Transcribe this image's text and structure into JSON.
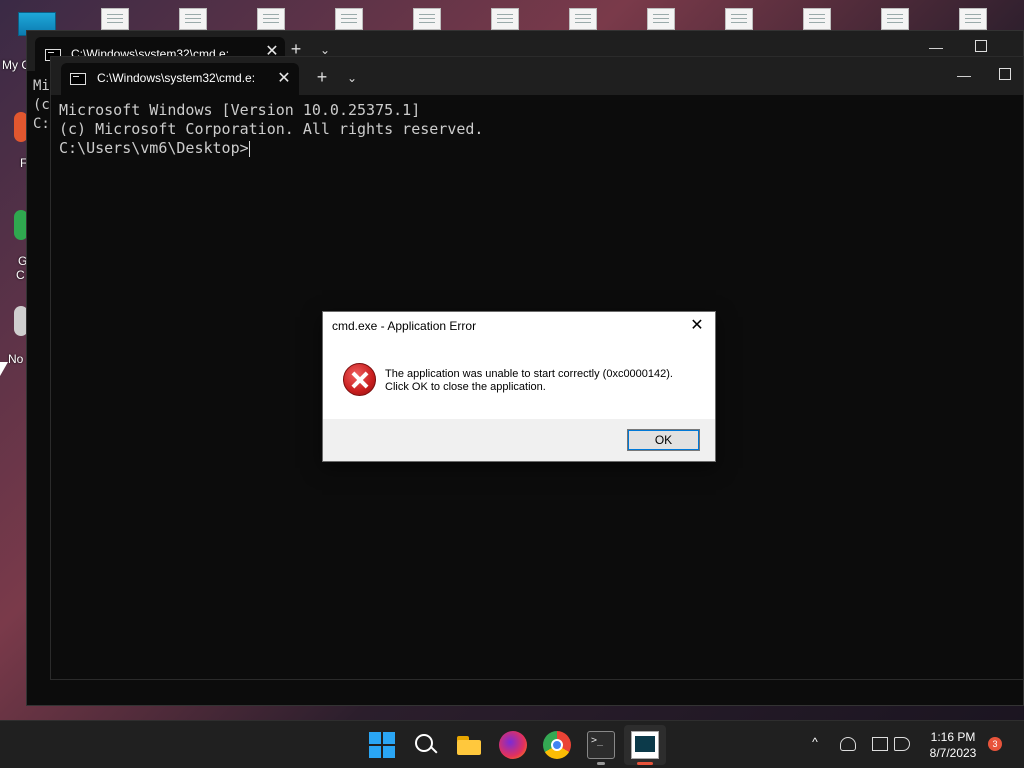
{
  "desktop": {
    "left_labels": [
      "My C",
      "F",
      "G",
      "C",
      "No"
    ]
  },
  "back_window": {
    "tab_title": "C:\\Windows\\system32\\cmd.e:",
    "lines": [
      "Mi",
      "(c",
      "",
      "C:"
    ]
  },
  "front_window": {
    "tab_title": "C:\\Windows\\system32\\cmd.e:",
    "tab_close": "✕",
    "new_tab": "+",
    "dropdown": "⌄",
    "minimize": "—",
    "console_lines": [
      "Microsoft Windows [Version 10.0.25375.1]",
      "(c) Microsoft Corporation. All rights reserved.",
      "",
      "C:\\Users\\vm6\\Desktop>"
    ]
  },
  "dialog": {
    "title": "cmd.exe - Application Error",
    "close": "✕",
    "message_line1": "The application was unable to start correctly (0xc0000142).",
    "message_line2": "Click OK to close the application.",
    "ok_label": "OK"
  },
  "taskbar": {
    "tray_arrow": "^",
    "time": "1:16 PM",
    "date": "8/7/2023",
    "notification_count": "3",
    "accent_color": "#2aa6f5",
    "running_indicator_color": "#999999",
    "active_indicator_color": "#e8543b"
  }
}
